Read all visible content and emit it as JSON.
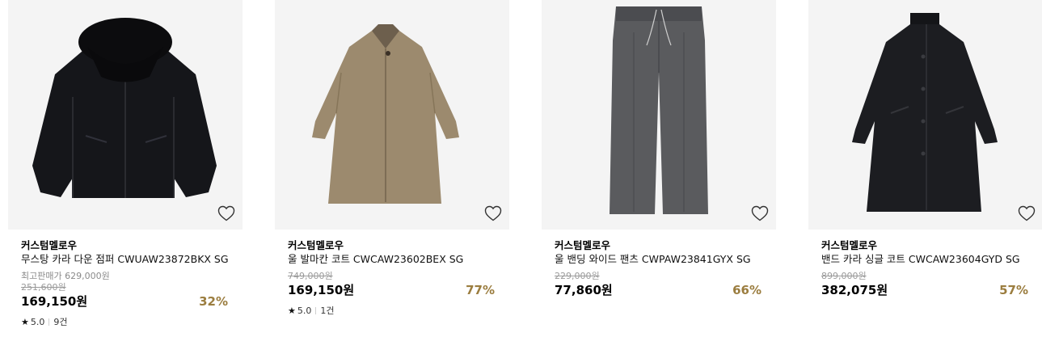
{
  "products": [
    {
      "brand": "커스텀멜로우",
      "name": "무스탕 카라 다운 점퍼 CWUAW23872BKX SG",
      "top_price": "최고판매가 629,000원",
      "original_price": "251,600원",
      "price": "169,150원",
      "discount": "32%",
      "rating": "5.0",
      "review_count": "9건",
      "image_icon": "black-down-jacket-image"
    },
    {
      "brand": "커스텀멜로우",
      "name": "울 발마칸 코트 CWCAW23602BEX SG",
      "original_price": "749,000원",
      "price": "169,150원",
      "discount": "77%",
      "rating": "5.0",
      "review_count": "1건",
      "image_icon": "beige-coat-image"
    },
    {
      "brand": "커스텀멜로우",
      "name": "울 밴딩 와이드 팬츠 CWPAW23841GYX SG",
      "original_price": "229,000원",
      "price": "77,860원",
      "discount": "66%",
      "image_icon": "grey-wide-pants-image"
    },
    {
      "brand": "커스텀멜로우",
      "name": "밴드 카라 싱글 코트 CWCAW23604GYD SG",
      "original_price": "899,000원",
      "price": "382,075원",
      "discount": "57%",
      "image_icon": "dark-coat-image"
    }
  ],
  "colors": {
    "discount": "#9b7d3f",
    "thumb_bg": "#f4f4f4"
  },
  "icons": {
    "wishlist": "heart-icon",
    "rating": "star-icon"
  }
}
